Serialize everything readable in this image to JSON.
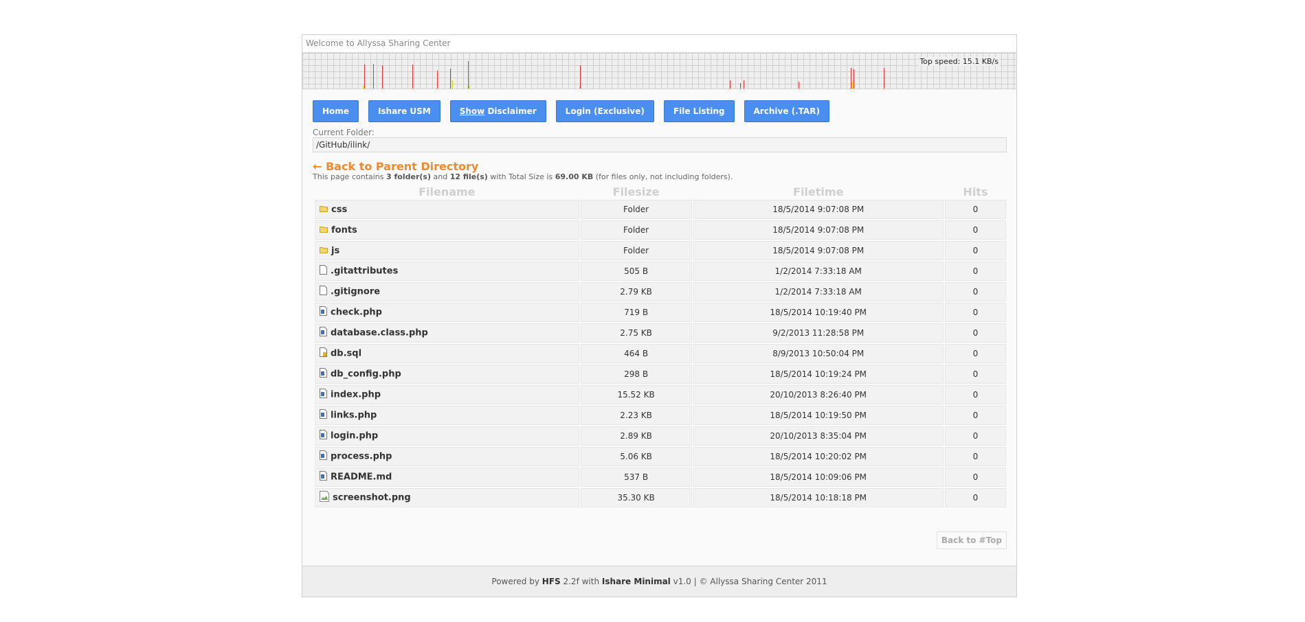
{
  "header": {
    "welcome": "Welcome to Allyssa Sharing Center"
  },
  "speed_graph": {
    "top_speed_label": "Top speed: 15.1 KB/s",
    "colors": {
      "upload": "#e03030",
      "download": "#c8d400"
    }
  },
  "nav": {
    "buttons": [
      {
        "label": "Home"
      },
      {
        "label": "Ishare USM"
      },
      {
        "label_underlined": "Show",
        "label_rest": " Disclaimer"
      },
      {
        "label": "Login (Exclusive)"
      },
      {
        "label": "File Listing"
      },
      {
        "label": "Archive (.TAR)"
      }
    ]
  },
  "folder": {
    "current_label": "Current Folder:",
    "path": "/GitHub/ilink/",
    "parent_link": "← Back to Parent Directory"
  },
  "summary": {
    "prefix": "This page contains ",
    "folders": "3 folder(s)",
    "and": " and ",
    "files": "12 file(s)",
    "total_text": " with Total Size is ",
    "total_size": "69.00 KB",
    "suffix": " (for files only, not including folders)."
  },
  "table": {
    "headers": {
      "name": "Filename",
      "size": "Filesize",
      "time": "Filetime",
      "hits": "Hits"
    },
    "rows": [
      {
        "icon": "folder-icon",
        "name": "css",
        "size": "Folder",
        "time": "18/5/2014 9:07:08 PM",
        "hits": "0"
      },
      {
        "icon": "folder-icon",
        "name": "fonts",
        "size": "Folder",
        "time": "18/5/2014 9:07:08 PM",
        "hits": "0"
      },
      {
        "icon": "folder-icon",
        "name": "js",
        "size": "Folder",
        "time": "18/5/2014 9:07:08 PM",
        "hits": "0"
      },
      {
        "icon": "file-icon",
        "name": ".gitattributes",
        "size": "505 B",
        "time": "1/2/2014 7:33:18 AM",
        "hits": "0"
      },
      {
        "icon": "file-icon",
        "name": ".gitignore",
        "size": "2.79 KB",
        "time": "1/2/2014 7:33:18 AM",
        "hits": "0"
      },
      {
        "icon": "php-file-icon",
        "name": "check.php",
        "size": "719 B",
        "time": "18/5/2014 10:19:40 PM",
        "hits": "0"
      },
      {
        "icon": "php-file-icon",
        "name": "database.class.php",
        "size": "2.75 KB",
        "time": "9/2/2013 11:28:58 PM",
        "hits": "0"
      },
      {
        "icon": "sql-file-icon",
        "name": "db.sql",
        "size": "464 B",
        "time": "8/9/2013 10:50:04 PM",
        "hits": "0"
      },
      {
        "icon": "php-file-icon",
        "name": "db_config.php",
        "size": "298 B",
        "time": "18/5/2014 10:19:24 PM",
        "hits": "0"
      },
      {
        "icon": "php-file-icon",
        "name": "index.php",
        "size": "15.52 KB",
        "time": "20/10/2013 8:26:40 PM",
        "hits": "0"
      },
      {
        "icon": "php-file-icon",
        "name": "links.php",
        "size": "2.23 KB",
        "time": "18/5/2014 10:19:50 PM",
        "hits": "0"
      },
      {
        "icon": "php-file-icon",
        "name": "login.php",
        "size": "2.89 KB",
        "time": "20/10/2013 8:35:04 PM",
        "hits": "0"
      },
      {
        "icon": "php-file-icon",
        "name": "process.php",
        "size": "5.06 KB",
        "time": "18/5/2014 10:20:02 PM",
        "hits": "0"
      },
      {
        "icon": "php-file-icon",
        "name": "README.md",
        "size": "537 B",
        "time": "18/5/2014 10:09:06 PM",
        "hits": "0"
      },
      {
        "icon": "broken-image-icon",
        "name": "screenshot.png",
        "size": "35.30 KB",
        "time": "18/5/2014 10:18:18 PM",
        "hits": "0"
      }
    ]
  },
  "back_to_top": "Back to #Top",
  "footer": {
    "powered": "Powered by ",
    "hfs": "HFS",
    "version": " 2.2f with ",
    "template": "Ishare Minimal",
    "rest": " v1.0 | © Allyssa Sharing Center 2011"
  }
}
